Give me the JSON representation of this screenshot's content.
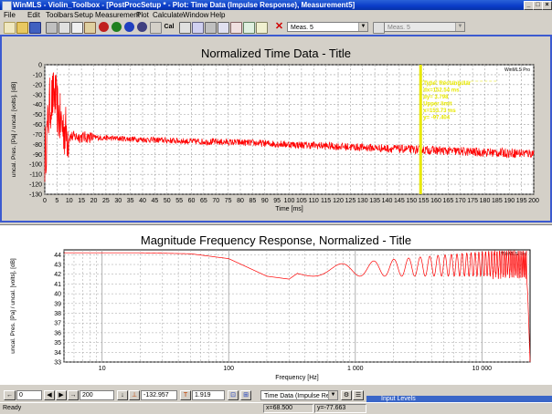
{
  "window": {
    "title": "WinMLS - Violin_Toolbox - [PostProcSetup * - Plot: Time Data (Impulse Response), Measurement5]"
  },
  "menu": [
    "File",
    "Edit",
    "Toolbars",
    "Setup",
    "Measurement",
    "Plot",
    "Calculate",
    "Window",
    "Help"
  ],
  "toolbar": {
    "cal_label": "Cal",
    "meas_select": "Meas. 5",
    "meas_select_2": "Meas. 5"
  },
  "plot1": {
    "title": "Normalized Time Data - Title",
    "xlabel": "Time [ms]",
    "ylabel": "uncal. Pres. [Pa] / uncal. [volts], [dB]",
    "corner_label": "WinMLS Pro",
    "annotation": [
      "Type: Rectangular",
      "dx=152.54 ms",
      "dy= 3.798",
      "Upper limit",
      "x=153.73 ms",
      "y= -97.404"
    ]
  },
  "plot2": {
    "title": "Magnitude Frequency Response, Normalized  - Title",
    "xlabel": "Frequency [Hz]",
    "ylabel": "uncal. Pres. [Pa] / uncal. [volts], [dB]",
    "corner_label": "WinMLS Pro"
  },
  "chart_data": [
    {
      "type": "line",
      "title": "Normalized Time Data - Title",
      "xlabel": "Time [ms]",
      "ylabel": "uncal. Pres. [Pa] / uncal. [volts], [dB]",
      "xlim": [
        0,
        200
      ],
      "ylim": [
        -130,
        0
      ],
      "xticks": [
        0,
        5,
        10,
        15,
        20,
        25,
        30,
        35,
        40,
        45,
        50,
        55,
        60,
        65,
        70,
        75,
        80,
        85,
        90,
        95,
        100,
        105,
        110,
        115,
        120,
        125,
        130,
        135,
        140,
        145,
        150,
        155,
        160,
        165,
        170,
        175,
        180,
        185,
        190,
        195,
        200
      ],
      "yticks": [
        0,
        -10,
        -20,
        -30,
        -40,
        -50,
        -60,
        -70,
        -80,
        -90,
        -100,
        -110,
        -120,
        -130
      ],
      "grid": true,
      "series": [
        {
          "x": [
            0,
            2,
            4,
            6,
            8,
            10,
            20,
            40,
            60,
            80,
            100,
            120,
            140,
            160,
            180,
            200
          ],
          "y": [
            -95,
            -40,
            -30,
            -55,
            -65,
            -72,
            -73,
            -75,
            -77,
            -78,
            -80,
            -82,
            -84,
            -86,
            -88,
            -89
          ]
        }
      ],
      "markers": [
        {
          "x": 153.73,
          "color": "#e8e800"
        }
      ]
    },
    {
      "type": "line",
      "title": "Magnitude Frequency Response, Normalized  - Title",
      "xlabel": "Frequency [Hz]",
      "ylabel": "uncal. Pres. [Pa] / uncal. [volts], [dB]",
      "xscale": "log",
      "xlim": [
        5,
        24000
      ],
      "ylim": [
        33,
        44.5
      ],
      "xticklabels": [
        "10",
        "100",
        "1 000",
        "10 000"
      ],
      "yticks": [
        44,
        43,
        42,
        41,
        40,
        39,
        38,
        37,
        36,
        35,
        34,
        33
      ],
      "grid": true,
      "series": [
        {
          "x": [
            5,
            10,
            20,
            50,
            100,
            200,
            300,
            500,
            1000,
            2000,
            5000,
            10000,
            15000,
            20000,
            22000,
            23000,
            24000
          ],
          "y": [
            44.2,
            44.2,
            44.2,
            44.1,
            43.6,
            41.8,
            41.5,
            43.5,
            44.0,
            44.0,
            44.0,
            44.1,
            44.0,
            44.3,
            43.8,
            40.0,
            33.0
          ]
        }
      ]
    }
  ],
  "bottom": {
    "start_value": "0",
    "end_value": "200",
    "y_min": "-132.957",
    "y_max": "1.919",
    "plot_select": "Time Data (Impulse Resp"
  },
  "status": {
    "ready": "Ready",
    "x_readout": "x=68.500",
    "y_readout": "y=-77.663",
    "input_levels": "Input Levels"
  },
  "colors": {
    "curve": "#ff0000",
    "marker": "#e8e800",
    "grid": "#a0a0a0",
    "title_bar": "#0a3cc8"
  }
}
